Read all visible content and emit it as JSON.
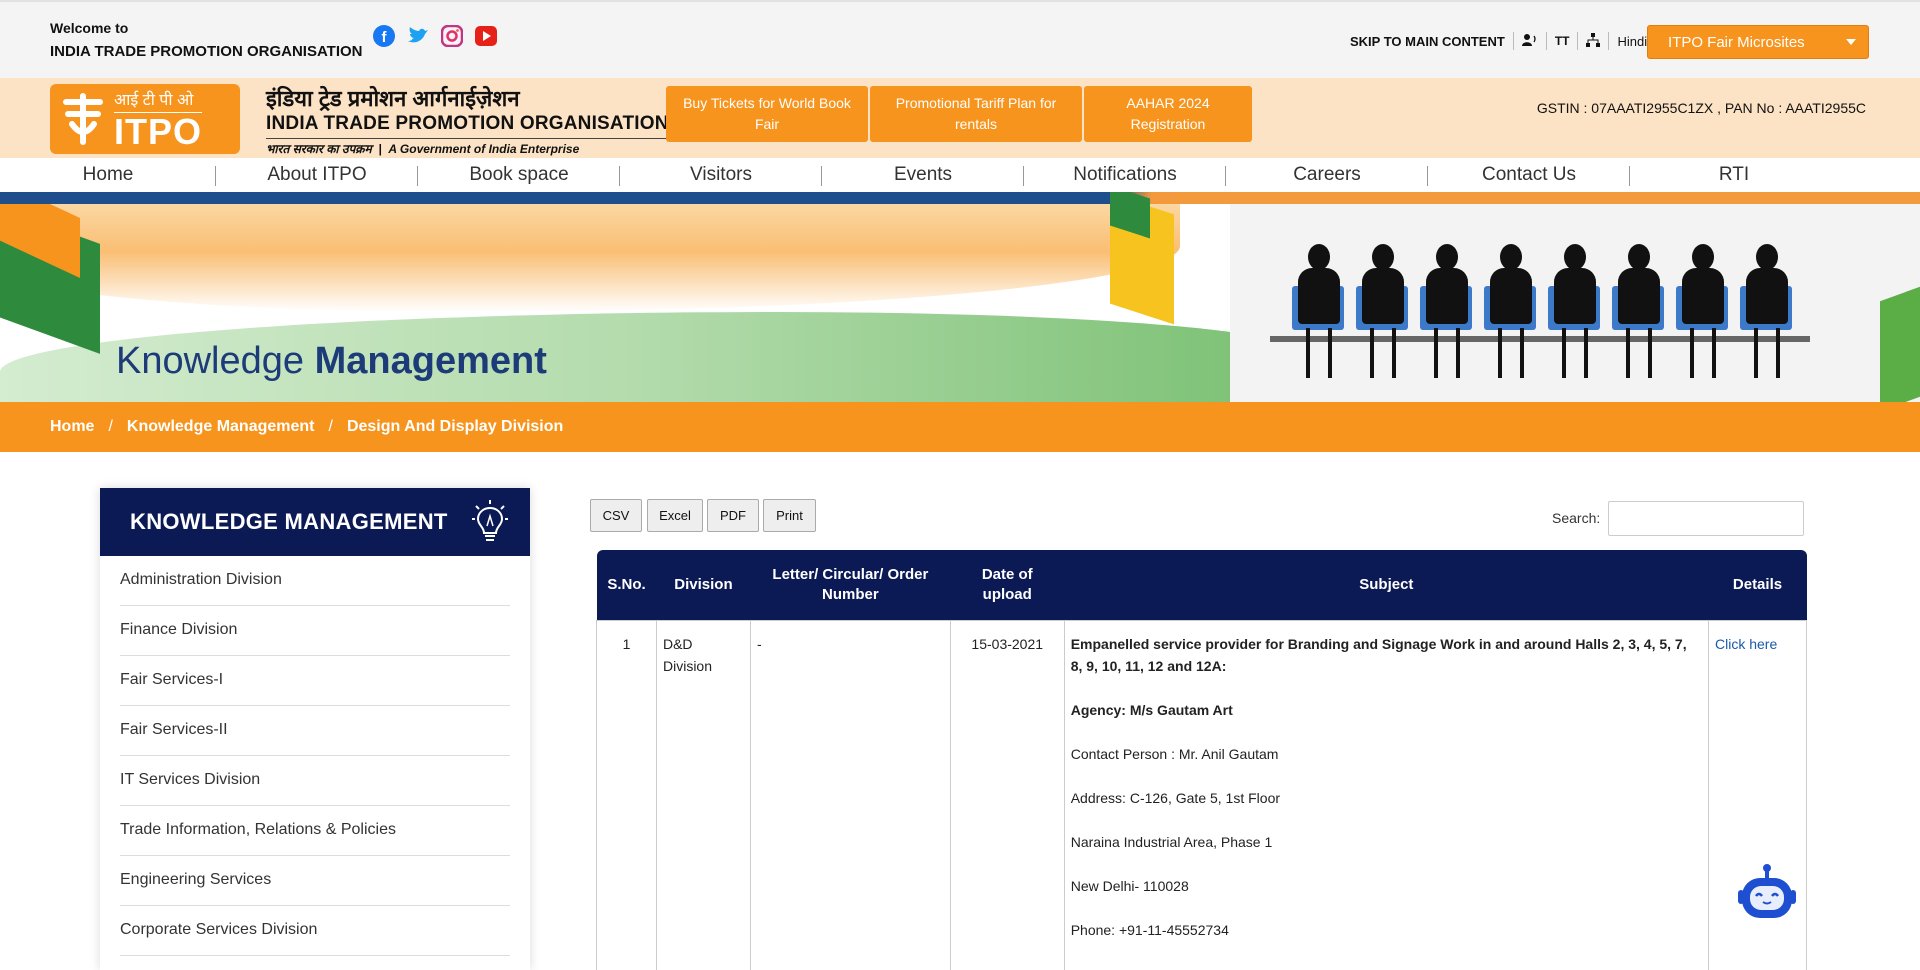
{
  "topbar": {
    "welcome_line1": "Welcome to",
    "welcome_line2": "INDIA TRADE PROMOTION ORGANISATION",
    "skip_link": "SKIP TO MAIN CONTENT",
    "text_size_label": "TT",
    "language": "Hindi",
    "microsites_label": "ITPO Fair Microsites",
    "social_icons": [
      "facebook-icon",
      "twitter-icon",
      "instagram-icon",
      "youtube-icon"
    ]
  },
  "brand": {
    "logo_hindi": "आई टी पी ओ",
    "logo_text": "ITPO",
    "org_hindi": "इंडिया ट्रेड प्रमोशन आर्गनाईज़ेशन",
    "org_english": "INDIA TRADE PROMOTION ORGANISATION",
    "org_sub_hindi": "भारत सरकार का उपक्रम",
    "org_sub_english": "A Government of India Enterprise",
    "highlights": [
      "Buy Tickets for World Book Fair",
      "Promotional Tariff Plan for rentals",
      "AAHAR 2024 Registration"
    ],
    "gstin": "GSTIN : 07AAATI2955C1ZX , PAN No : AAATI2955C"
  },
  "nav": {
    "items": [
      "Home",
      "About ITPO",
      "Book space",
      "Visitors",
      "Events",
      "Notifications",
      "Careers",
      "Contact Us",
      "RTI"
    ]
  },
  "banner": {
    "title_light": "Knowledge ",
    "title_bold": "Management"
  },
  "breadcrumb": {
    "items": [
      "Home",
      "Knowledge Management",
      "Design And Display Division"
    ],
    "separator": "/"
  },
  "sidebar": {
    "heading": "KNOWLEDGE MANAGEMENT",
    "items": [
      "Administration Division",
      "Finance Division",
      "Fair Services-I",
      "Fair Services-II",
      "IT Services Division",
      "Trade Information, Relations & Policies",
      "Engineering Services",
      "Corporate Services Division"
    ]
  },
  "toolbar": {
    "buttons": [
      "CSV",
      "Excel",
      "PDF",
      "Print"
    ],
    "search_label": "Search:",
    "search_value": ""
  },
  "table": {
    "headers": [
      "S.No.",
      "Division",
      "Letter/ Circular/ Order Number",
      "Date of upload",
      "Subject",
      "Details"
    ],
    "rows": [
      {
        "sno": "1",
        "division": "D&D Division",
        "number": "-",
        "date": "15-03-2021",
        "subject_title": "Empanelled service provider for Branding and Signage Work in and around Halls 2, 3, 4, 5, 7, 8, 9, 10, 11, 12 and 12A:",
        "agency": "Agency: M/s Gautam Art",
        "contact": "Contact Person : Mr. Anil Gautam",
        "address1": "Address: C-126, Gate 5, 1st Floor",
        "address2": "Naraina Industrial Area, Phase 1",
        "address3": "New Delhi- 110028",
        "phone": "Phone: +91-11-45552734",
        "details_link": "Click here"
      }
    ]
  },
  "colors": {
    "accent_orange": "#f7941d",
    "navy": "#0b1a55",
    "brand_bar": "#fde3c5",
    "link": "#1a5aa8"
  }
}
